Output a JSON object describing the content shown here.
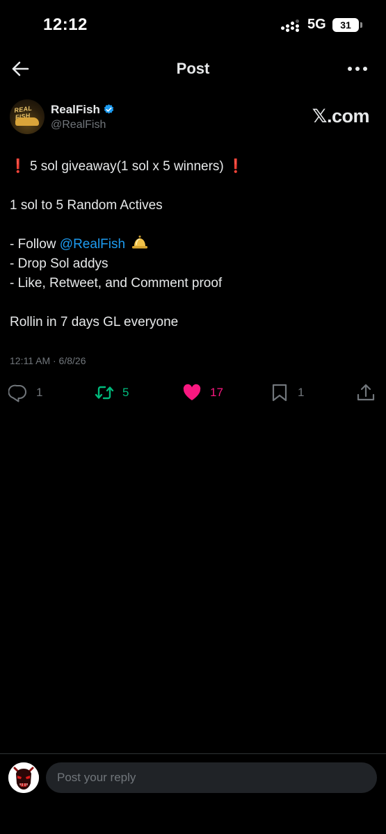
{
  "status_bar": {
    "time": "12:12",
    "network": "5G",
    "battery": "31"
  },
  "header": {
    "title": "Post",
    "back_icon": "arrow-left-icon",
    "more_icon": "more-dots-icon"
  },
  "author": {
    "name": "RealFish",
    "handle": "@RealFish",
    "avatar_text": "REAL FISH",
    "verified": true,
    "source": "𝕏.com"
  },
  "tweet": {
    "line1": "5 sol giveaway(1 sol x 5 winners)",
    "line1_prefix": "❗",
    "line1_suffix": "❗",
    "line2": "1 sol to 5 Random Actives",
    "line3_prefix": "- Follow ",
    "line3_mention": "@RealFish",
    "line4": "- Drop Sol addys",
    "line5": "- Like, Retweet, and Comment proof",
    "line6": "Rollin in 7 days GL everyone"
  },
  "timestamp": "12:11 AM · 6/8/26",
  "actions": {
    "replies": "1",
    "retweets": "5",
    "likes": "17",
    "bookmarks": "1"
  },
  "reply": {
    "placeholder": "Post your reply"
  },
  "colors": {
    "accent": "#1d9bf0",
    "retweet": "#00ba7c",
    "like": "#f91880",
    "muted": "#71767b",
    "background": "#000000"
  }
}
